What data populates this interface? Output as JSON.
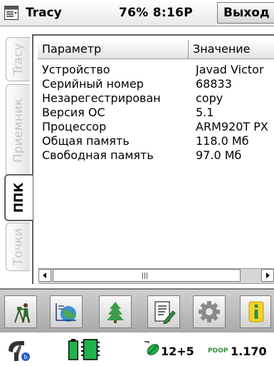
{
  "titlebar": {
    "menu_icon": "list-menu-icon",
    "title": "Tracy",
    "status": "76% 8:16P",
    "exit_label": "Выход"
  },
  "tabs": [
    {
      "label": "Tracy",
      "active": false
    },
    {
      "label": "Приемник",
      "active": false
    },
    {
      "label": "ППК",
      "active": true
    },
    {
      "label": "Точки",
      "active": false
    }
  ],
  "table": {
    "columns": [
      "Параметр",
      "Значение"
    ],
    "rows": [
      {
        "param": "Устройство",
        "value": "Javad Victor"
      },
      {
        "param": "Серийный номер",
        "value": "68833"
      },
      {
        "param": "Незарегестрирован",
        "value": "copy"
      },
      {
        "param": "Версия ОС",
        "value": "5.1"
      },
      {
        "param": "Процессор",
        "value": "ARM920T PX"
      },
      {
        "param": "Общая память",
        "value": "118.0 Мб"
      },
      {
        "param": "Свободная память",
        "value": "97.0 Мб"
      }
    ]
  },
  "toolbar": {
    "buttons": [
      "surveyor-icon",
      "globe-coordinates-icon",
      "tree-icon",
      "notes-pen-icon",
      "gear-icon",
      "info-icon"
    ]
  },
  "statusbar": {
    "receiver_icon": "receiver-icon",
    "battery_icon": "battery-icon",
    "memory_icon": "memory-chip-icon",
    "satellite_icon": "satellite-icon",
    "satellites": "12+5",
    "pdop_label": "PDOP",
    "pdop_value": "1.170"
  },
  "colors": {
    "accent_green": "#22b14c",
    "gear_grey": "#8a8a8a",
    "info_yellow": "#f4d22a"
  }
}
